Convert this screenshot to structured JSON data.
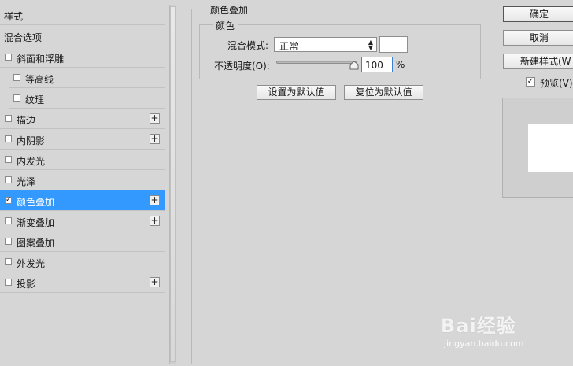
{
  "style_list": {
    "header": "样式",
    "blend_options": "混合选项",
    "items": [
      {
        "label": "斜面和浮雕",
        "checked": false,
        "has_add": false
      },
      {
        "label": "等高线",
        "checked": false,
        "has_add": false
      },
      {
        "label": "纹理",
        "checked": false,
        "has_add": false
      },
      {
        "label": "描边",
        "checked": false,
        "has_add": true
      },
      {
        "label": "内阴影",
        "checked": false,
        "has_add": true
      },
      {
        "label": "内发光",
        "checked": false,
        "has_add": false
      },
      {
        "label": "光泽",
        "checked": false,
        "has_add": false
      },
      {
        "label": "颜色叠加",
        "checked": true,
        "has_add": true,
        "selected": true
      },
      {
        "label": "渐变叠加",
        "checked": false,
        "has_add": true
      },
      {
        "label": "图案叠加",
        "checked": false,
        "has_add": false
      },
      {
        "label": "外发光",
        "checked": false,
        "has_add": false
      },
      {
        "label": "投影",
        "checked": false,
        "has_add": true
      }
    ],
    "add_symbol": "+",
    "check_symbol": "✓"
  },
  "color_overlay": {
    "group_title": "颜色叠加",
    "subgroup_title": "颜色",
    "blend_mode_label": "混合模式:",
    "blend_mode_value": "正常",
    "opacity_label": "不透明度(O):",
    "opacity_value": "100",
    "opacity_percent": 100,
    "opacity_unit": "%",
    "swatch_color": "#ffffff",
    "make_default_button": "设置为默认值",
    "reset_default_button": "复位为默认值"
  },
  "actions": {
    "ok_button": "确定",
    "cancel_button": "取消",
    "new_style_button": "新建样式(W",
    "preview_label": "预览(V)",
    "preview_checked": true
  },
  "colors": {
    "selection": "#3399ff",
    "panel": "#d6d6d6",
    "preview_swatch": "#ffffff"
  },
  "watermark": {
    "brand": "Bai经验",
    "url": "jingyan.baidu.com"
  }
}
